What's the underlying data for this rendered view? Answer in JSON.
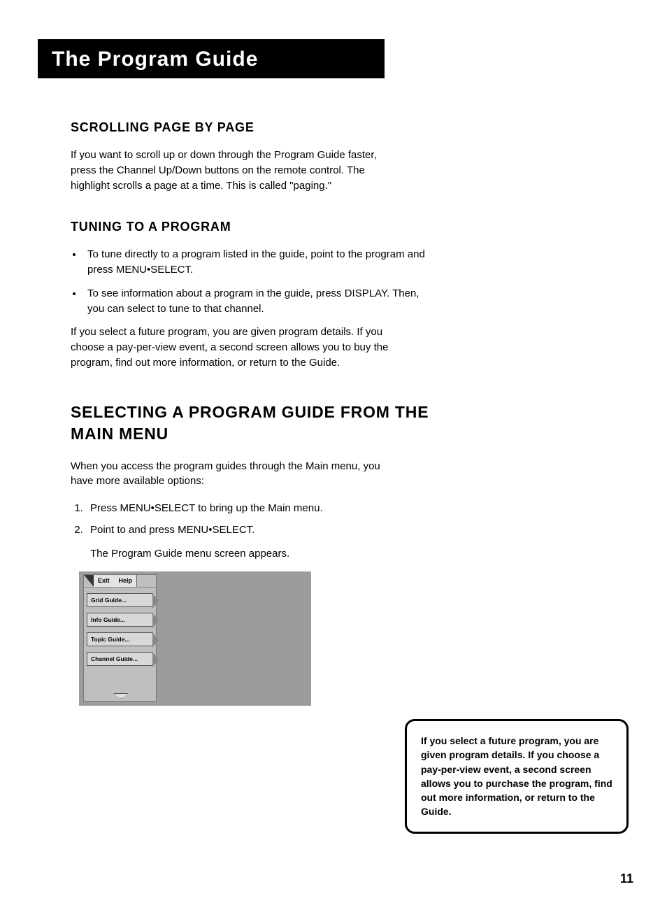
{
  "title": "The Program Guide",
  "sections": {
    "scrolling": {
      "heading": "Scrolling Page by Page",
      "body": "If you want to scroll up or down through the Program Guide faster, press the Channel Up/Down buttons on the remote control. The highlight scrolls a page at a time. This is called \"paging.\""
    },
    "tuning": {
      "heading": "Tuning to a Program",
      "bullets": [
        "To tune directly to a program listed in the guide, point to the program and press MENU•SELECT.",
        "To see information about a program in the guide, press DISPLAY. Then, you can select                       to tune to that channel."
      ],
      "after": "If you select a future program, you are given program details. If you choose a pay-per-view event, a second screen allows you to buy the program, find out more information, or return to the Guide."
    },
    "selecting": {
      "heading": "Selecting a Program Guide from the Main Menu",
      "intro": "When you access the program guides through the Main menu, you have more available options:",
      "steps": [
        "Press MENU•SELECT to bring up the Main menu.",
        "Point to                       and press MENU•SELECT."
      ],
      "stepnote": "The Program Guide menu screen appears."
    }
  },
  "screenshot": {
    "tabs": {
      "exit": "Exit",
      "help": "Help"
    },
    "items": [
      "Grid Guide...",
      "Info Guide...",
      "Topic Guide...",
      "Channel Guide..."
    ]
  },
  "callout": "If you select a future program, you are given program details. If you choose a pay-per-view event, a second screen allows you to purchase the program, find out more information, or return to the Guide.",
  "page_number": "11"
}
